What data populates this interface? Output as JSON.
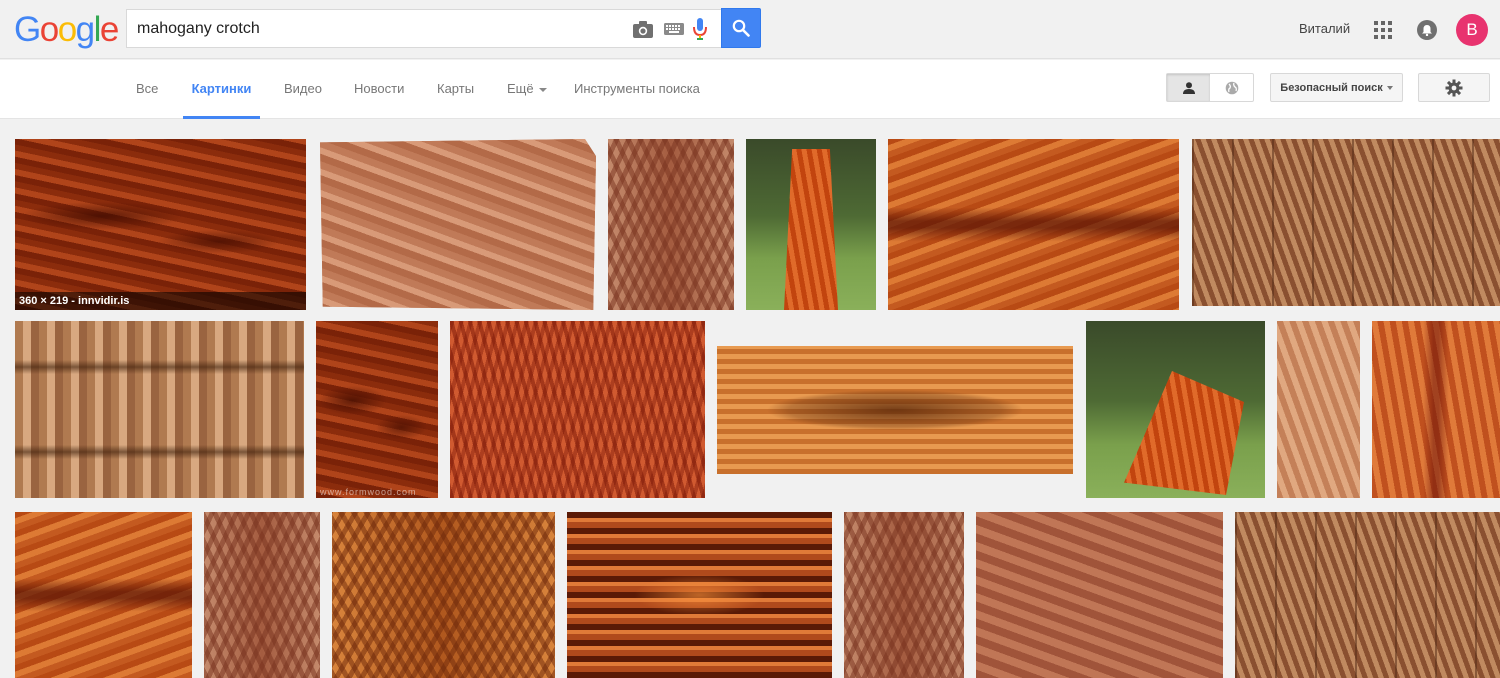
{
  "header": {
    "logo_letters": [
      "G",
      "o",
      "o",
      "g",
      "l",
      "e"
    ],
    "logo_colors": [
      "#4285f4",
      "#ea4335",
      "#fbbc05",
      "#4285f4",
      "#34a853",
      "#ea4335"
    ],
    "search_query": "mahogany crotch",
    "user_name": "Виталий",
    "avatar_letter": "B",
    "avatar_color": "#e8336f"
  },
  "icons": {
    "camera": "camera-icon",
    "keyboard": "keyboard-icon",
    "mic": "microphone-icon",
    "search": "search-icon",
    "apps": "apps-grid-icon",
    "notifications": "notifications-bell-icon",
    "person": "person-icon",
    "globe": "globe-icon",
    "settings": "gear-icon"
  },
  "nav": {
    "tabs": [
      {
        "label": "Все",
        "active": false
      },
      {
        "label": "Картинки",
        "active": true
      },
      {
        "label": "Видео",
        "active": false
      },
      {
        "label": "Новости",
        "active": false
      },
      {
        "label": "Карты",
        "active": false
      },
      {
        "label": "Ещё",
        "active": false,
        "dropdown": true
      },
      {
        "label": "Инструменты поиска",
        "active": false
      }
    ],
    "safe_search_label": "Безопасный поиск"
  },
  "results": {
    "first_caption": "360 × 219 - innvidir.is",
    "watermark": "www.formwood.com"
  },
  "colors": {
    "accent": "#4285f4",
    "background": "#f1f1f1"
  }
}
